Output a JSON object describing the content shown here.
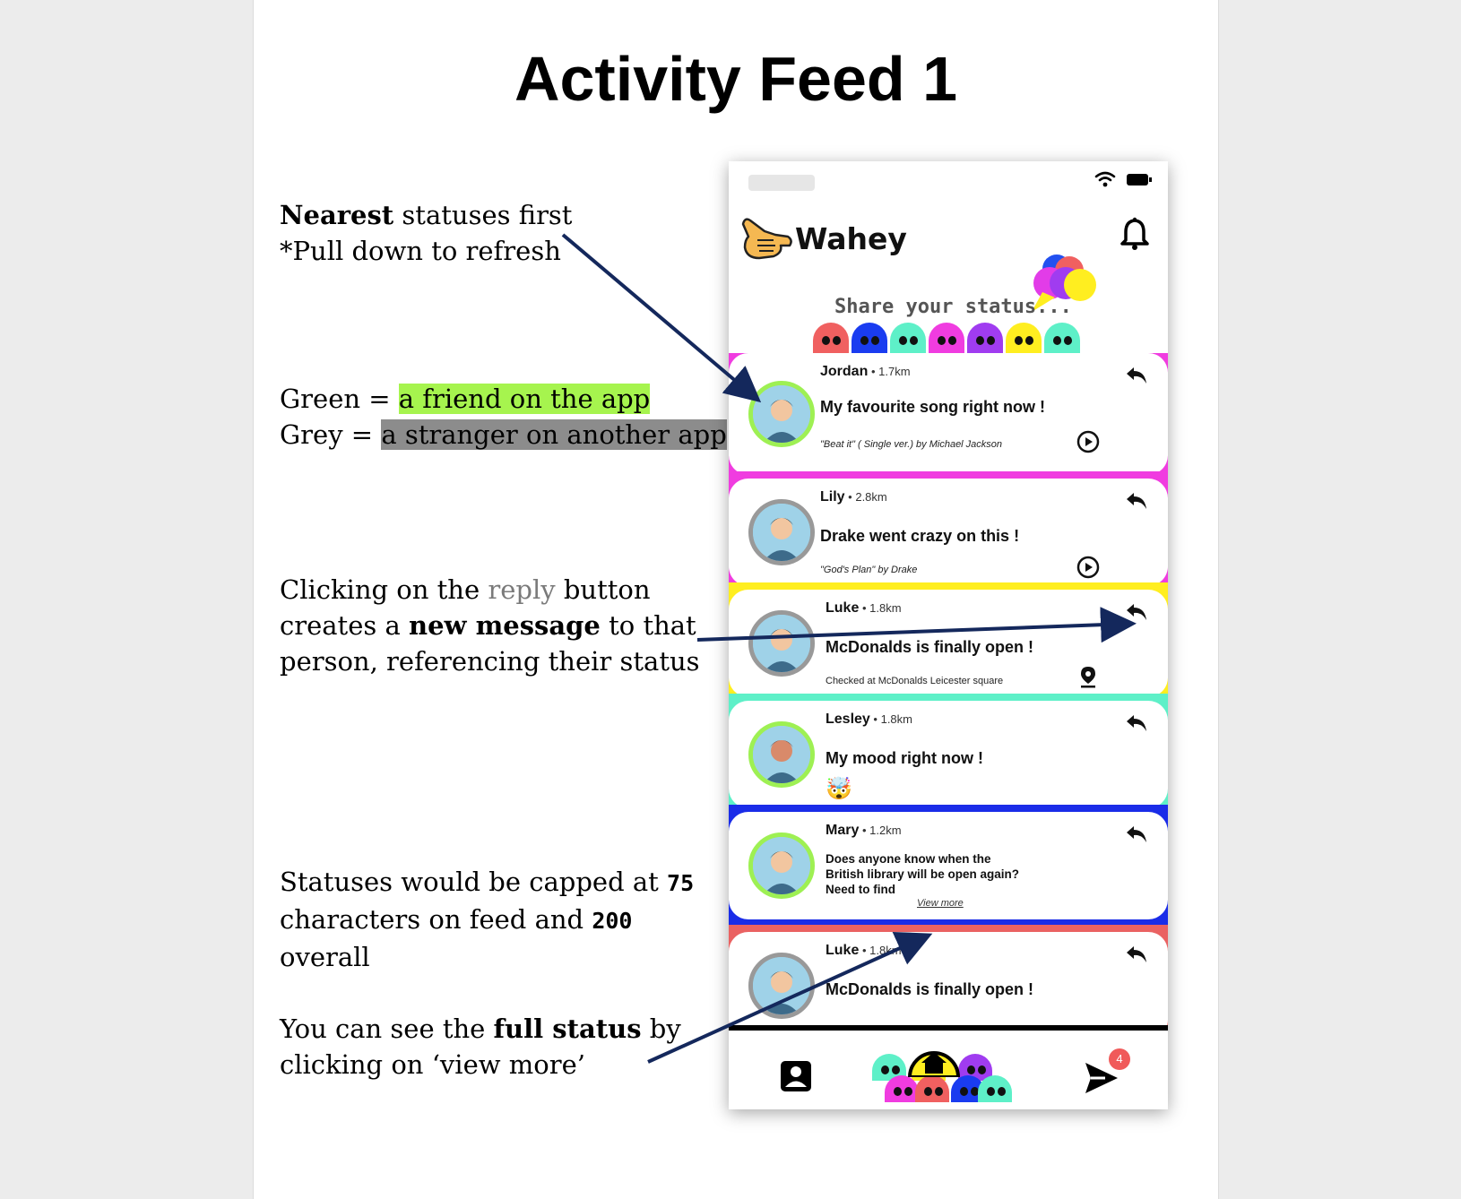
{
  "page": {
    "title": "Activity Feed 1"
  },
  "notes": {
    "n1": {
      "bold": "Nearest",
      "rest": " statuses first",
      "line2": "*Pull down to refresh"
    },
    "n2": {
      "green_prefix": "Green = ",
      "green_text": "a friend on the app",
      "grey_prefix": "Grey = ",
      "grey_text": "a stranger on another app"
    },
    "n3": {
      "p1": "Clicking on the ",
      "reply_word": "reply",
      "p2": " button",
      "l2_a": "creates a ",
      "l2_bold": "new message",
      "l2_b": " to that",
      "l3": "person, referencing their status"
    },
    "n4": {
      "l1": "Statuses would be capped at ",
      "n75": "75",
      "l2": "characters on feed and ",
      "n200": "200",
      "l3": "overall"
    },
    "n5": {
      "l1": "You can see the ",
      "bold": "full status",
      "l1b": " by",
      "l2": "clicking on ‘view more’"
    }
  },
  "app": {
    "name": "Wahey",
    "share_prompt": "Share your status...",
    "notification_count": "4",
    "blob_colors": [
      "#f06060",
      "#1a3cf0",
      "#5ef0c8",
      "#f03ce0",
      "#a03cf0",
      "#ffee20",
      "#5ef0c8"
    ],
    "nav_blob_colors": [
      "#5ef0c8",
      "#ffee20",
      "#a03cf0",
      "#f03ce0",
      "#f06060",
      "#1a3cf0",
      "#5ef0c8"
    ],
    "icons": [
      "wifi-icon",
      "battery-icon",
      "hand-logo-icon",
      "bell-icon",
      "reply-icon",
      "play-icon",
      "location-pin-icon",
      "profile-icon",
      "home-icon",
      "send-icon"
    ]
  },
  "feed": [
    {
      "name": "Jordan",
      "dist": "1.7km",
      "text": "My favourite song right now !",
      "sub": "\"Beat it\" ( Single ver.) by Michael Jackson",
      "action": "play",
      "friend": true,
      "band": "#f03ce0"
    },
    {
      "name": "Lily",
      "dist": "2.8km",
      "text": "Drake went crazy on this !",
      "sub": "\"God's Plan\" by Drake",
      "action": "play",
      "friend": false,
      "band": "#f03ce0"
    },
    {
      "name": "Luke",
      "dist": "1.8km",
      "text": "McDonalds is finally open !",
      "sub": "Checked at McDonalds Leicester square",
      "action": "location",
      "friend": false,
      "band": "#ffee20"
    },
    {
      "name": "Lesley",
      "dist": "1.8km",
      "text": "My mood right now !",
      "sub": "🤯",
      "action": "none",
      "friend": true,
      "band": "#5ef0c8"
    },
    {
      "name": "Mary",
      "dist": "1.2km",
      "text_lines": [
        "Does anyone know when the",
        "British library will be open again?",
        "Need to find"
      ],
      "view_more": "View more",
      "action": "none",
      "friend": true,
      "band": "#1a2ce8"
    },
    {
      "name": "Luke",
      "dist": "1.8km",
      "text": "McDonalds is finally open !",
      "friend": false,
      "band": "#ea6262"
    }
  ]
}
